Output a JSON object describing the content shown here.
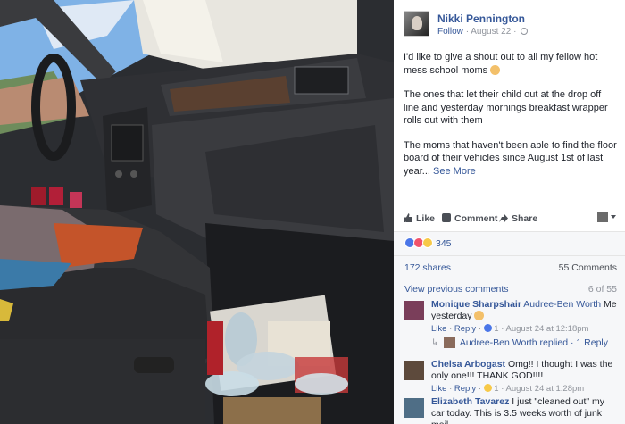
{
  "post": {
    "author": "Nikki Pennington",
    "follow_label": "Follow",
    "date": "August 22",
    "paragraphs": [
      "I'd like to give a shout out to all my fellow hot mess school moms",
      "The ones that let their child out at the drop off line and yesterday mornings breakfast wrapper rolls out with them",
      "The moms that haven't been able to find the floor board of their vehicles since August 1st of last year..."
    ],
    "see_more_label": "See More"
  },
  "actions": {
    "like_label": "Like",
    "comment_label": "Comment",
    "share_label": "Share"
  },
  "feedback": {
    "reaction_count": "345",
    "shares": "172 shares",
    "comments": "55 Comments",
    "view_previous": "View previous comments",
    "pager": "6 of 55"
  },
  "comments": [
    {
      "name": "Monique Sharpshair",
      "tag": "Audree-Ben Worth",
      "text": "Me yesterday",
      "like_label": "Like",
      "reply_label": "Reply",
      "reactions": "1",
      "time": "August 24 at 12:18pm",
      "reply_summary": {
        "name": "Audree-Ben Worth",
        "text": "replied",
        "count": "1 Reply"
      }
    },
    {
      "name": "Chelsa Arbogast",
      "text": "Omg!! I thought I was the only one!!! THANK GOD!!!!",
      "like_label": "Like",
      "reply_label": "Reply",
      "reactions": "1",
      "time": "August 24 at 1:28pm"
    },
    {
      "name": "Elizabeth Tavarez",
      "text": "I just \"cleaned out\" my car today. This is 3.5 weeks worth of junk mail,"
    }
  ],
  "colors": {
    "link": "#365899",
    "muted": "#90949c",
    "like_reaction": "#4a76e8",
    "love_reaction": "#f0526b",
    "haha_reaction": "#f7c948"
  }
}
